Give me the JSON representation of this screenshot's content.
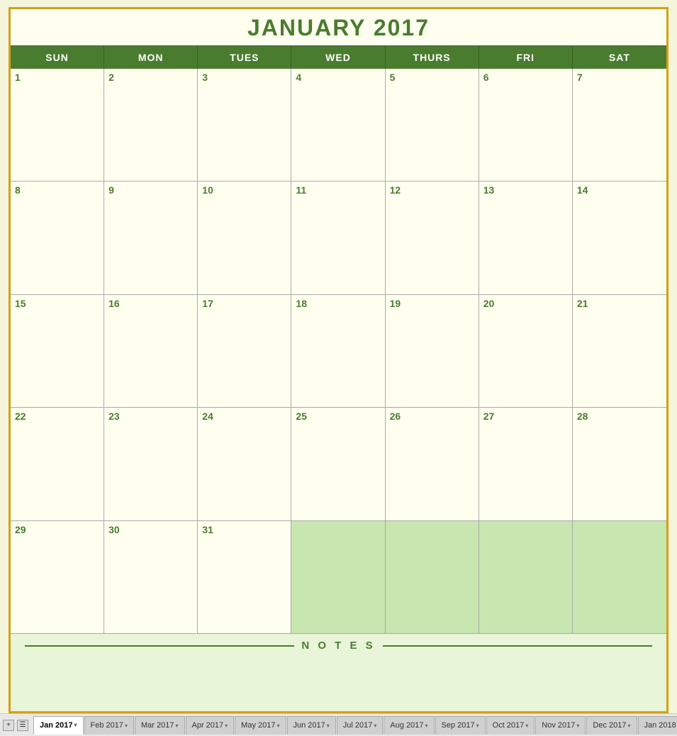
{
  "calendar": {
    "title": "JANUARY 2017",
    "headers": [
      "SUN",
      "MON",
      "TUES",
      "WED",
      "THURS",
      "FRI",
      "SAT"
    ],
    "weeks": [
      [
        {
          "day": 1,
          "empty": false
        },
        {
          "day": 2,
          "empty": false
        },
        {
          "day": 3,
          "empty": false
        },
        {
          "day": 4,
          "empty": false
        },
        {
          "day": 5,
          "empty": false
        },
        {
          "day": 6,
          "empty": false
        },
        {
          "day": 7,
          "empty": false
        }
      ],
      [
        {
          "day": 8,
          "empty": false
        },
        {
          "day": 9,
          "empty": false
        },
        {
          "day": 10,
          "empty": false
        },
        {
          "day": 11,
          "empty": false
        },
        {
          "day": 12,
          "empty": false
        },
        {
          "day": 13,
          "empty": false
        },
        {
          "day": 14,
          "empty": false
        }
      ],
      [
        {
          "day": 15,
          "empty": false
        },
        {
          "day": 16,
          "empty": false
        },
        {
          "day": 17,
          "empty": false
        },
        {
          "day": 18,
          "empty": false
        },
        {
          "day": 19,
          "empty": false
        },
        {
          "day": 20,
          "empty": false
        },
        {
          "day": 21,
          "empty": false
        }
      ],
      [
        {
          "day": 22,
          "empty": false
        },
        {
          "day": 23,
          "empty": false
        },
        {
          "day": 24,
          "empty": false
        },
        {
          "day": 25,
          "empty": false
        },
        {
          "day": 26,
          "empty": false
        },
        {
          "day": 27,
          "empty": false
        },
        {
          "day": 28,
          "empty": false
        }
      ],
      [
        {
          "day": 29,
          "empty": false
        },
        {
          "day": 30,
          "empty": false
        },
        {
          "day": 31,
          "empty": false
        },
        {
          "day": null,
          "empty": true
        },
        {
          "day": null,
          "empty": true
        },
        {
          "day": null,
          "empty": true
        },
        {
          "day": null,
          "empty": true
        }
      ]
    ],
    "notes_label": "N O T E S"
  },
  "tabs": [
    {
      "label": "Jan 2017",
      "active": true
    },
    {
      "label": "Feb 2017",
      "active": false
    },
    {
      "label": "Mar 2017",
      "active": false
    },
    {
      "label": "Apr 2017",
      "active": false
    },
    {
      "label": "May 2017",
      "active": false
    },
    {
      "label": "Jun 2017",
      "active": false
    },
    {
      "label": "Jul 2017",
      "active": false
    },
    {
      "label": "Aug 2017",
      "active": false
    },
    {
      "label": "Sep 2017",
      "active": false
    },
    {
      "label": "Oct 2017",
      "active": false
    },
    {
      "label": "Nov 2017",
      "active": false
    },
    {
      "label": "Dec 2017",
      "active": false
    },
    {
      "label": "Jan 2018",
      "active": false
    }
  ]
}
